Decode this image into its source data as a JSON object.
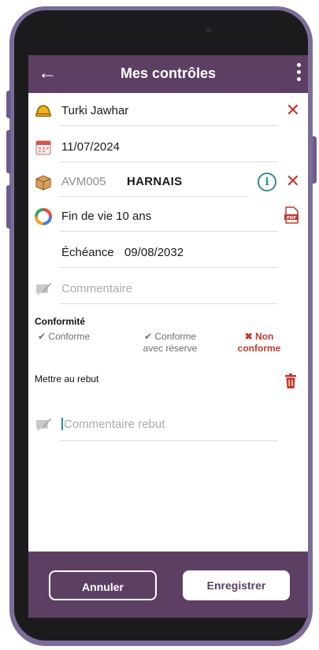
{
  "header": {
    "title": "Mes contrôles",
    "back_icon": "arrow-left-icon",
    "menu_icon": "kebab-menu-icon"
  },
  "form": {
    "inspector": {
      "value": "Turki Jawhar",
      "icon": "helmet-icon"
    },
    "date": {
      "value": "11/07/2024",
      "icon": "calendar-icon"
    },
    "equipment": {
      "code": "AVM005",
      "name": "HARNAIS",
      "icon": "box-icon"
    },
    "lifespan": {
      "value": "Fin de vie 10 ans",
      "icon": "cycle-icon"
    },
    "due": {
      "label": "Échéance",
      "value": "09/08/2032"
    },
    "comment": {
      "placeholder": "Commentaire",
      "icon": "note-icon"
    },
    "conformity": {
      "label": "Conformité",
      "options": [
        {
          "mark": "✔",
          "line1": "Conforme",
          "line2": ""
        },
        {
          "mark": "✔",
          "line1": "Conforme",
          "line2": "avec réserve"
        },
        {
          "mark": "✖",
          "line1": "Non",
          "line2": "conforme"
        }
      ],
      "selected_index": 2
    },
    "discard": {
      "label": "Mettre au rebut"
    },
    "discard_comment": {
      "placeholder": "Commentaire rebut"
    }
  },
  "footer": {
    "cancel_label": "Annuler",
    "save_label": "Enregistrer"
  },
  "colors": {
    "primary": "#5d3f63",
    "danger": "#c0392b",
    "teal": "#3a8a8f",
    "frame": "#7d6c99"
  }
}
